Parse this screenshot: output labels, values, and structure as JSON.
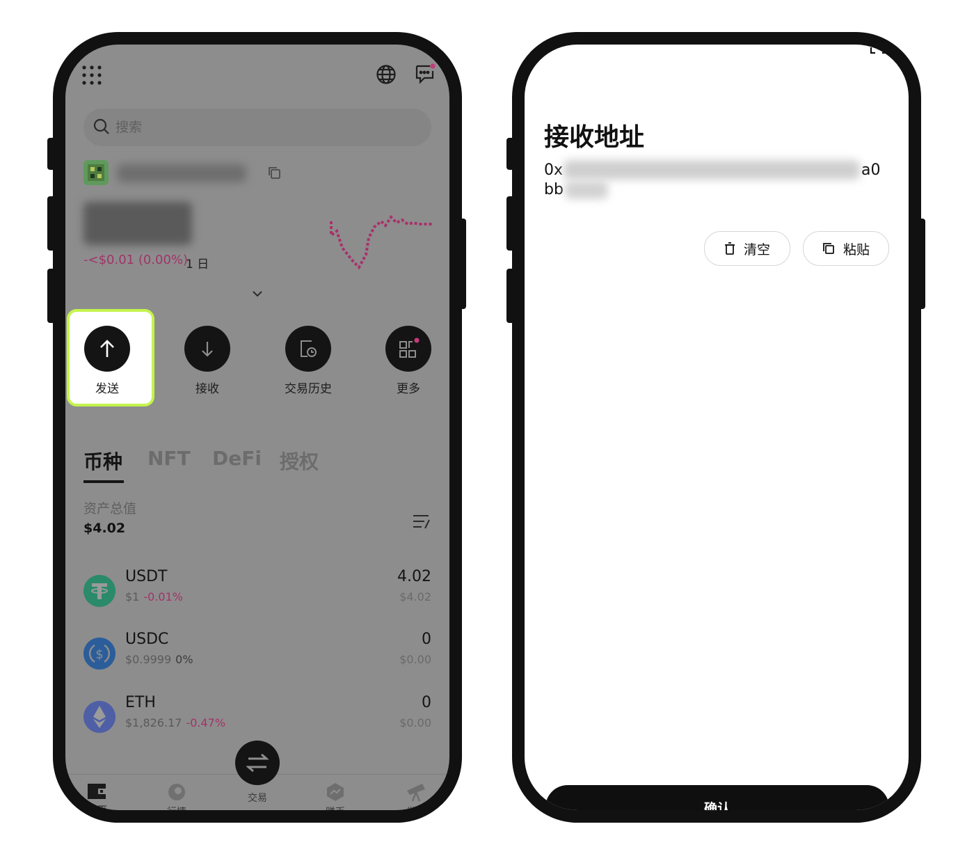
{
  "left_screen": {
    "search": {
      "placeholder": "搜索"
    },
    "wallet": {
      "change": "-<$0.01 (0.00%)",
      "period": "1 日"
    },
    "actions": [
      {
        "label": "发送",
        "icon": "arrow-up-icon"
      },
      {
        "label": "接收",
        "icon": "arrow-down-icon"
      },
      {
        "label": "交易历史",
        "icon": "history-icon"
      },
      {
        "label": "更多",
        "icon": "grid-icon"
      }
    ],
    "tabs": [
      "币种",
      "NFT",
      "DeFi",
      "授权"
    ],
    "total": {
      "label": "资产总值",
      "value": "$4.02"
    },
    "tokens": [
      {
        "symbol": "USDT",
        "price": "$1",
        "change": "-0.01%",
        "amount": "4.02",
        "value": "$4.02",
        "color": "#26a17b"
      },
      {
        "symbol": "USDC",
        "price": "$0.9999",
        "change": "0%",
        "amount": "0",
        "value": "$0.00",
        "color": "#2775ca"
      },
      {
        "symbol": "ETH",
        "price": "$1,826.17",
        "change": "-0.47%",
        "amount": "0",
        "value": "$0.00",
        "color": "#627eea"
      }
    ],
    "nav": [
      {
        "label": "首页",
        "icon": "wallet-icon"
      },
      {
        "label": "行情",
        "icon": "market-icon"
      },
      {
        "label": "交易",
        "icon": "swap-icon"
      },
      {
        "label": "赚币",
        "icon": "earn-icon"
      },
      {
        "label": "发现",
        "icon": "discover-icon"
      }
    ]
  },
  "right_screen": {
    "title": "接收地址",
    "address_line1_prefix": "0x",
    "address_line1_suffix": "a0",
    "address_line2_prefix": "bb",
    "buttons": {
      "clear": "清空",
      "paste": "粘贴"
    },
    "confirm": "确认"
  },
  "colors": {
    "accent_highlight": "#c4f44b",
    "negative": "#a03467"
  }
}
